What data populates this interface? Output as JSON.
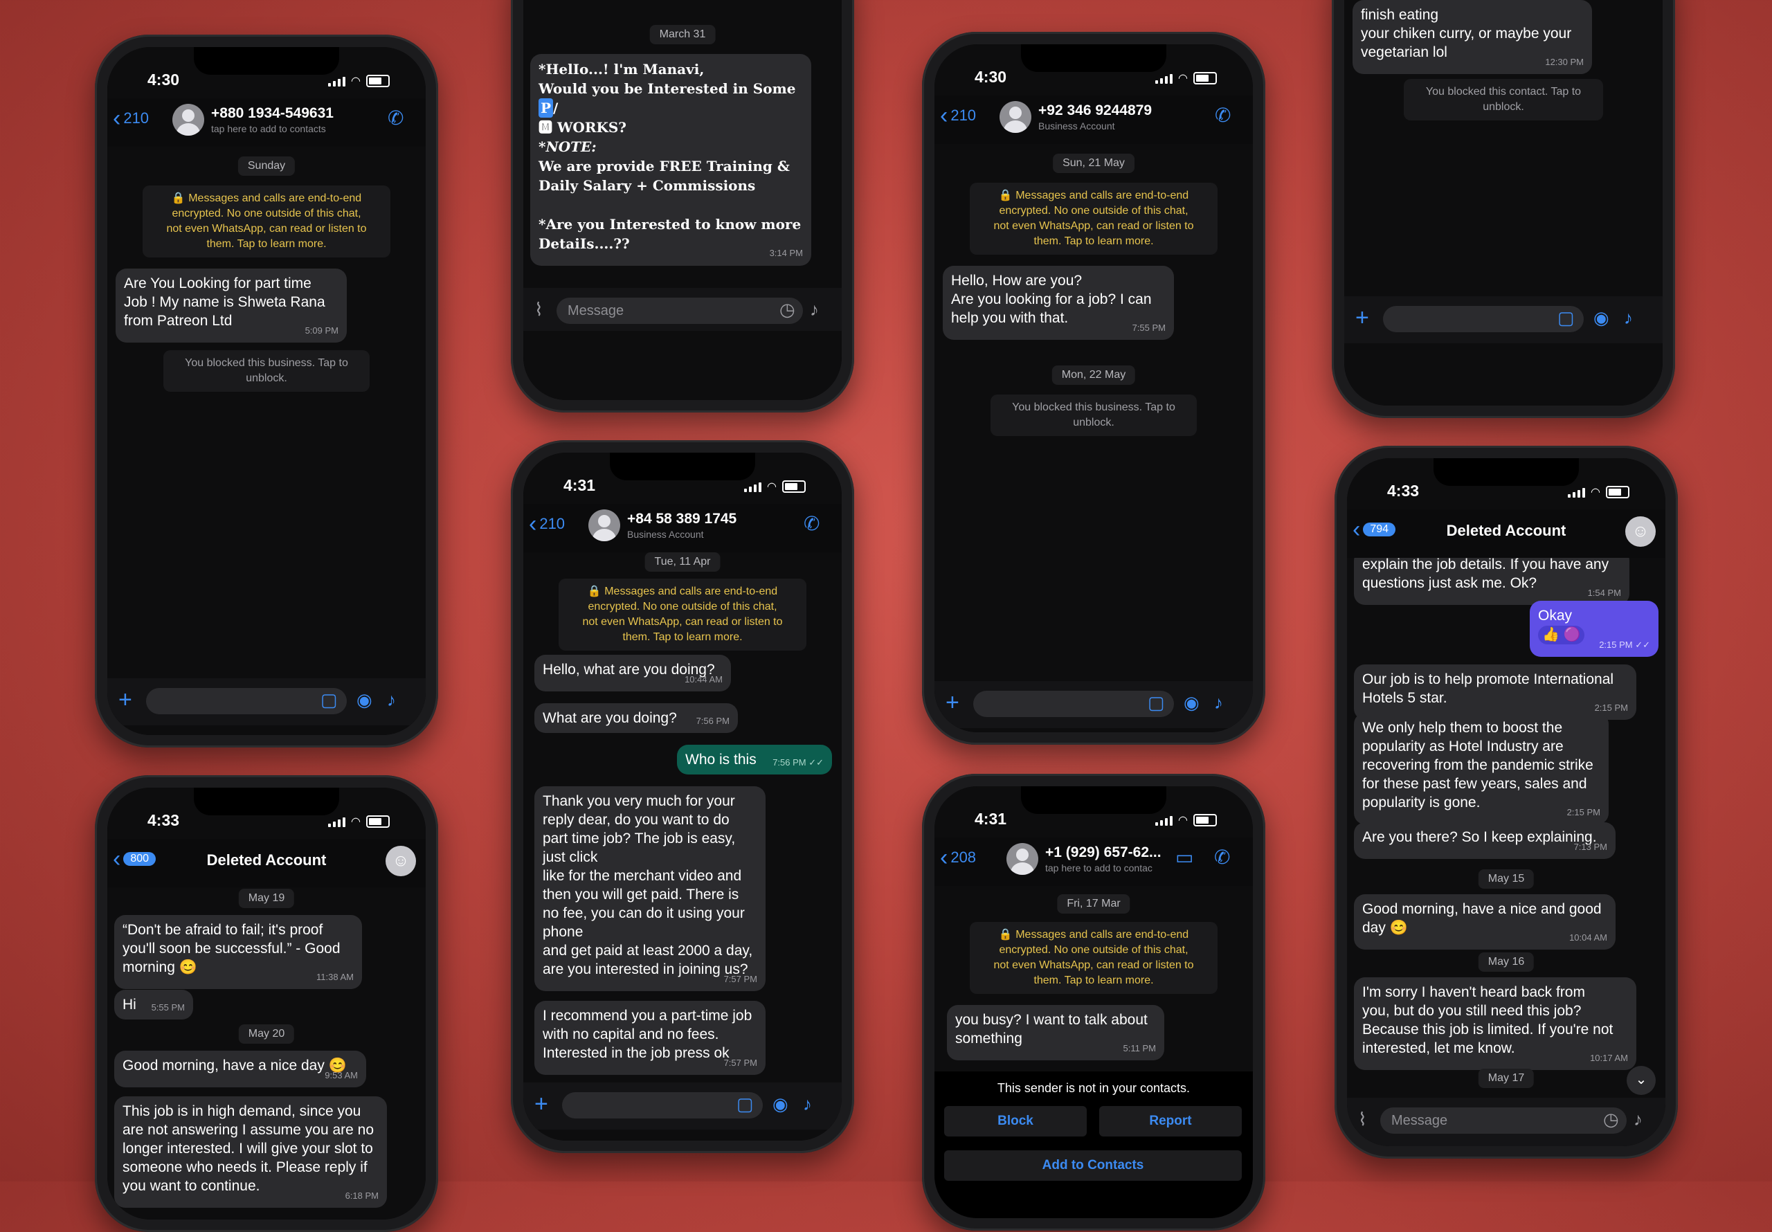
{
  "status_times": {
    "p1": "4:30",
    "p2": "4:31",
    "p3": "4:30",
    "p5": "4:33",
    "p6": "4:33",
    "p7": "4:31"
  },
  "p1": {
    "back_count": "210",
    "name": "+880 1934-549631",
    "sub": "tap here to add to contacts",
    "date": "Sunday",
    "enc": [
      "🔒 Messages and calls are end-to-end",
      "encrypted. No one outside of this chat,",
      "not even WhatsApp, can read or listen to",
      "them. Tap to learn more."
    ],
    "msg1": [
      "Are You Looking for part time",
      "Job  ! My name is Shweta Rana",
      "from Patreon Ltd"
    ],
    "msg1_time": "5:09 PM",
    "blocked": [
      "You blocked this business. Tap to",
      "unblock."
    ]
  },
  "p2": {
    "date": "March 31",
    "msg": [
      "*HelIo...!  l'm Manavi,",
      "Would you be Interested in Some",
      "WORKS?",
      "*NOTE:",
      "We are provide FREE Training &",
      "Daily Salary + Commissions",
      "",
      "*Are you Interested to know more",
      "DetaiIs....??"
    ],
    "p_chip": "P",
    "inline_prefix": "🅼 ",
    "time": "3:14 PM",
    "input_placeholder": "Message"
  },
  "p3": {
    "back_count": "210",
    "name": "+92 346 9244879",
    "sub": "Business Account",
    "date1": "Sun, 21 May",
    "enc": [
      "🔒 Messages and calls are end-to-end",
      "encrypted. No one outside of this chat,",
      "not even WhatsApp, can read or listen to",
      "them. Tap to learn more."
    ],
    "msg1": [
      "Hello, How are you?",
      "Are you looking for a job? I can",
      "help you with that."
    ],
    "msg1_time": "7:55 PM",
    "date2": "Mon, 22 May",
    "blocked": [
      "You blocked this business. Tap to",
      "unblock."
    ]
  },
  "p4": {
    "msg": [
      "finish eating",
      "your chiken curry, or maybe your",
      "vegetarian lol"
    ],
    "time": "12:30 PM",
    "blocked": [
      "You blocked this contact. Tap to",
      "unblock."
    ]
  },
  "p5": {
    "back_count": "210",
    "name": "+84 58 389 1745",
    "sub": "Business Account",
    "date": "Tue, 11 Apr",
    "enc": [
      "🔒 Messages and calls are end-to-end",
      "encrypted. No one outside of this chat,",
      "not even WhatsApp, can read or listen to",
      "them. Tap to learn more."
    ],
    "m1": "Hello, what are you doing?",
    "m1_time": "10:44 AM",
    "m2": "What are you doing?",
    "m2_time": "7:56 PM",
    "m3": "Who is this",
    "m3_time": "7:56 PM ✓✓",
    "m4": [
      "Thank you very much for your",
      "reply dear, do you want to do",
      "part time job? The job is easy,",
      "just click",
      "like for the merchant video and",
      "then you will get paid. There is",
      "no fee, you can do it using your",
      "phone",
      "and get paid at least 2000 a day,",
      "are you interested in joining us?"
    ],
    "m4_time": "7:57 PM",
    "m5": [
      "I recommend you a part-time job",
      "with no capital and no fees.",
      "Interested in the job press ok"
    ],
    "m5_time": "7:57 PM"
  },
  "p6": {
    "back_count": "800",
    "title": "Deleted Account",
    "d1": "May 19",
    "m1": [
      "“Don't be afraid to fail; it's proof",
      "you'll soon be successful.” - Good",
      "morning 😊"
    ],
    "m1_time": "11:38 AM",
    "m2": "Hi",
    "m2_time": "5:55 PM",
    "d2": "May 20",
    "m3": "Good morning, have a nice day 😊",
    "m3_time": "9:53 AM",
    "m4": [
      "This job is in high demand, since you",
      "are not answering I assume you are no",
      "longer interested. I will give your slot to",
      "someone who needs it. Please reply if",
      "you want to continue."
    ],
    "m4_time": "6:18 PM"
  },
  "p7": {
    "back_count": "208",
    "name": "+1 (929) 657-62...",
    "sub": "tap here to add to contac",
    "date": "Fri, 17 Mar",
    "enc": [
      "🔒 Messages and calls are end-to-end",
      "encrypted. No one outside of this chat,",
      "not even WhatsApp, can read or listen to",
      "them. Tap to learn more."
    ],
    "msg": [
      "you busy? I want to talk about",
      "something"
    ],
    "time": "5:11 PM",
    "banner": "This sender is not in your contacts.",
    "block": "Block",
    "report": "Report",
    "add": "Add to Contacts"
  },
  "p8": {
    "back_count": "794",
    "title": "Deleted Account",
    "m0": [
      "explain the job details. If you have any",
      "questions just ask me. Ok?"
    ],
    "m0_time": "1:54 PM",
    "m1": "Okay",
    "m1_time": "2:15 PM ✓✓",
    "m1_reacts": "👍 🟣",
    "m2": [
      "Our job is to help promote International",
      "Hotels 5 star."
    ],
    "m2_time": "2:15 PM",
    "m3": [
      "We only help them to boost the",
      "popularity as Hotel Industry are",
      "recovering from the pandemic strike",
      "for these past few years, sales and",
      "popularity is gone."
    ],
    "m3_time": "2:15 PM",
    "m4": "Are you there? So I keep explaining.",
    "m4_time": "7:13 PM",
    "d1": "May 15",
    "m5": [
      "Good morning, have a nice and good",
      "day 😊"
    ],
    "m5_time": "10:04 AM",
    "d2": "May 16",
    "m6": [
      "I'm sorry I haven't heard back from",
      "you, but do you still need this job?",
      "Because this job is limited. If you're not",
      "interested, let me know."
    ],
    "m6_time": "10:17 AM",
    "d3": "May 17",
    "input_placeholder": "Message"
  },
  "icons": {
    "back": "chevron-left-icon",
    "call_add": "phone-plus-icon",
    "plus": "plus-icon",
    "sticker": "sticker-icon",
    "camera": "camera-icon",
    "mic": "microphone-icon",
    "attach": "paperclip-icon",
    "clock": "clock-icon",
    "video": "video-icon",
    "phone": "phone-icon",
    "ghost": "ghost-icon"
  },
  "colors": {
    "accent": "#3c8bf2",
    "encryption_text": "#e7c44e",
    "outgoing": "#0c5e4f",
    "purple_bubble": "#5f4fe6",
    "background": "#b8443d"
  }
}
